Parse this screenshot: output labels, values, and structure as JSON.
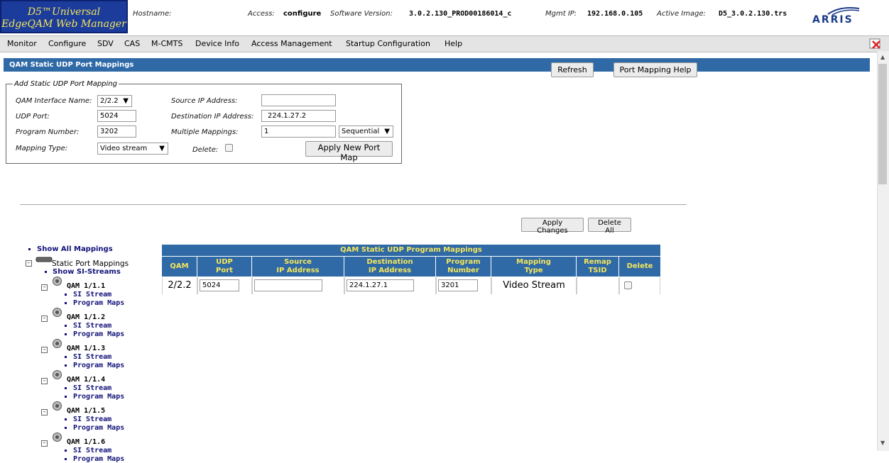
{
  "header": {
    "logo_line1": "D5™Universal",
    "logo_line2": "EdgeQAM Web Manager",
    "hostname_label": "Hostname:",
    "access_label": "Access:",
    "access_value": "configure",
    "software_label": "Software Version:",
    "software_value": "3.0.2.130_PROD00186014_c",
    "mgmt_label": "Mgmt IP:",
    "mgmt_value": "192.168.0.105",
    "image_label": "Active Image:",
    "image_value": "D5_3.0.2.130.trs",
    "brand": "ARRIS"
  },
  "menu": [
    "Monitor",
    "Configure",
    "SDV",
    "CAS",
    "M-CMTS",
    "Device Info",
    "Access Management",
    "Startup Configuration",
    "Help"
  ],
  "section": {
    "title": "QAM Static UDP Port Mappings",
    "refresh": "Refresh",
    "help": "Port Mapping Help"
  },
  "form": {
    "legend": "Add Static UDP Port Mapping",
    "qam_label": "QAM Interface Name:",
    "qam_value": "2/2.2",
    "udp_label": "UDP Port:",
    "udp_value": "5024",
    "program_label": "Program Number:",
    "program_value": "3202",
    "mapping_label": "Mapping Type:",
    "mapping_value": "Video stream",
    "source_label": "Source IP Address:",
    "source_value": "",
    "dest_label": "Destination IP Address:",
    "dest_value": "224.1.27.2",
    "multi_label": "Multiple Mappings:",
    "multi_value": "1",
    "multi_mode": "Sequential",
    "delete_label": "Delete:",
    "apply": "Apply New Port Map"
  },
  "actions": {
    "apply_changes": "Apply Changes",
    "delete_all": "Delete All"
  },
  "tree": {
    "show_all": "Show All Mappings",
    "static": "Static Port Mappings",
    "show_si": "Show SI-Streams",
    "si_label": "SI Stream",
    "pm_label": "Program Maps",
    "qams": [
      "QAM 1/1.1",
      "QAM 1/1.2",
      "QAM 1/1.3",
      "QAM 1/1.4",
      "QAM 1/1.5",
      "QAM 1/1.6"
    ]
  },
  "table": {
    "title": "QAM Static UDP Program Mappings",
    "headers": {
      "qam": "QAM",
      "udp1": "UDP",
      "udp2": "Port",
      "src1": "Source",
      "src2": "IP Address",
      "dst1": "Destination",
      "dst2": "IP Address",
      "prog1": "Program",
      "prog2": "Number",
      "map1": "Mapping",
      "map2": "Type",
      "remap1": "Remap",
      "remap2": "TSID",
      "del": "Delete"
    },
    "row": {
      "qam": "2/2.2",
      "udp": "5024",
      "source": "",
      "dest": "224.1.27.1",
      "program": "3201",
      "mapping": "Video Stream"
    }
  }
}
